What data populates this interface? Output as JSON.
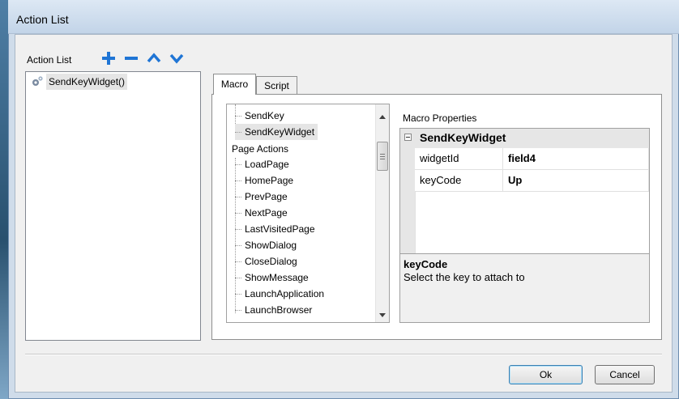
{
  "window": {
    "title": "Action List"
  },
  "action_list": {
    "label": "Action List",
    "items": [
      "SendKeyWidget()"
    ]
  },
  "toolbar": {
    "add_icon": "plus-icon",
    "remove_icon": "minus-icon",
    "up_icon": "arrow-up-icon",
    "down_icon": "arrow-down-icon",
    "accent_color": "#1f75d5"
  },
  "tabs": [
    {
      "label": "Macro",
      "active": true
    },
    {
      "label": "Script",
      "active": false
    }
  ],
  "macro_tree": {
    "items_top": [
      "SendKey",
      "SendKeyWidget"
    ],
    "group": "Page Actions",
    "items": [
      "LoadPage",
      "HomePage",
      "PrevPage",
      "NextPage",
      "LastVisitedPage",
      "ShowDialog",
      "CloseDialog",
      "ShowMessage",
      "LaunchApplication",
      "LaunchBrowser"
    ],
    "selected": "SendKeyWidget"
  },
  "properties": {
    "label": "Macro Properties",
    "section": "SendKeyWidget",
    "rows": [
      {
        "name": "widgetId",
        "value": "field4"
      },
      {
        "name": "keyCode",
        "value": "Up"
      }
    ],
    "help_title": "keyCode",
    "help_text": "Select the key to attach to"
  },
  "buttons": {
    "ok": "Ok",
    "cancel": "Cancel"
  }
}
